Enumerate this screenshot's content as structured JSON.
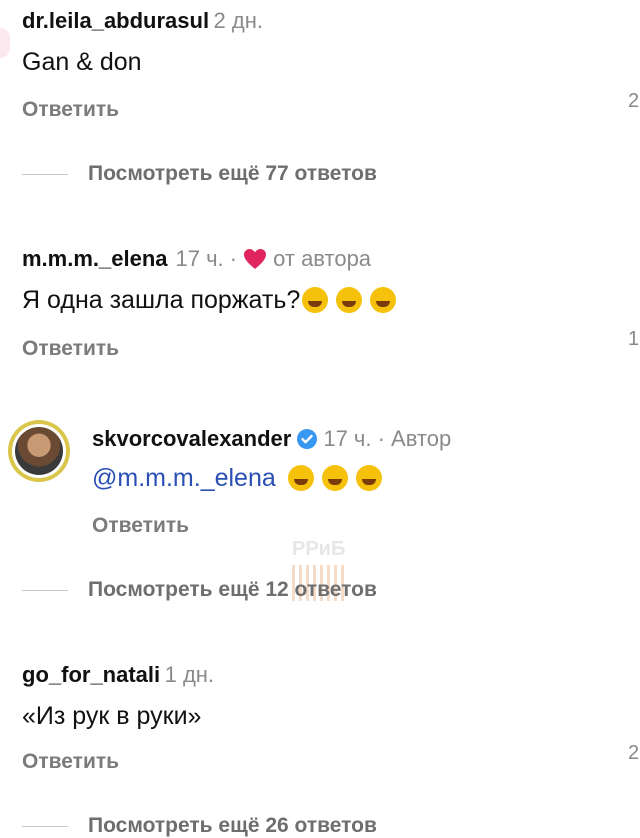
{
  "comments": [
    {
      "username": "dr.leila_abdurasul",
      "time": "2 дн.",
      "text": "Gan & don",
      "reply_label": "Ответить",
      "like_count": "2"
    },
    {
      "username": "m.m.m._elena",
      "time": "17 ч. ·",
      "author_like": "от автора",
      "text": "Я одна зашла поржать?",
      "emoji": [
        "rofl-emoji",
        "rofl-emoji",
        "rofl-emoji"
      ],
      "reply_label": "Ответить",
      "like_count": "1"
    },
    {
      "username": "go_for_natali",
      "time": "1 дн.",
      "text": "«Из рук в руки»",
      "reply_label": "Ответить",
      "like_count": "2"
    }
  ],
  "reply": {
    "username": "skvorcovalexander",
    "verified": true,
    "time": "17 ч. · Автор",
    "mention": "@m.m.m._elena",
    "emoji": [
      "joy-emoji",
      "joy-emoji",
      "joy-emoji"
    ],
    "reply_label": "Ответить"
  },
  "view_more": [
    "Посмотреть ещё 77 ответов",
    "Посмотреть ещё 12 ответов",
    "Посмотреть ещё 26 ответов"
  ],
  "watermark": "PPиБ",
  "colors": {
    "heart": "#e0245e",
    "verified": "#3897f0",
    "mention": "#2a4fb5",
    "avatar_ring": "#d9c64a"
  }
}
